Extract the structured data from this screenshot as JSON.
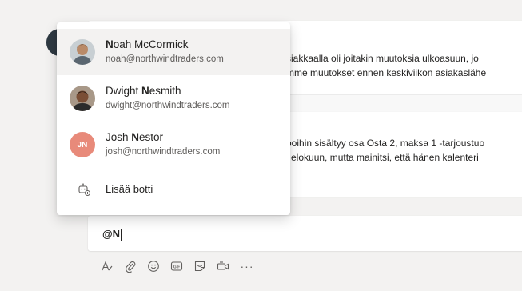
{
  "dropdown": {
    "items": [
      {
        "name_before": "",
        "name_match": "N",
        "name_after": "oah McCormick",
        "email": "noah@northwindtraders.com",
        "avatar": "photo"
      },
      {
        "name_before": "Dwight ",
        "name_match": "N",
        "name_after": "esmith",
        "email": "dwight@northwindtraders.com",
        "avatar": "photo"
      },
      {
        "name_before": "Josh ",
        "name_match": "N",
        "name_after": "estor",
        "email": "josh@northwindtraders.com",
        "avatar": "initials",
        "initials": "JN"
      }
    ],
    "add_bot_label": "Lisää botti",
    "add_bot_icon": "bot-add-icon"
  },
  "posts": [
    {
      "lines": [
        "siakkaalla oli joitakin muutoksia ulkoasuun, jo",
        "mme muutokset ennen keskiviikon asiakaslähe"
      ]
    },
    {
      "lines": [
        "poihin sisältyy osa Osta 2, maksa 1 -tarjoustuo",
        "i elokuun, mutta mainitsi, että hänen kalenteri"
      ]
    }
  ],
  "compose": {
    "value": "@N"
  },
  "toolbar": {
    "icons": [
      "format-icon",
      "attach-icon",
      "emoji-icon",
      "gif-icon",
      "sticker-icon",
      "meet-icon",
      "more-icon"
    ],
    "gif_label": "GIF",
    "more_label": "···"
  }
}
